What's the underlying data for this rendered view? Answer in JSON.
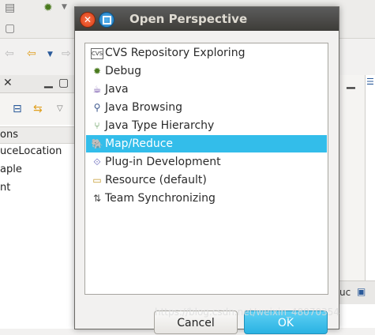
{
  "dialog": {
    "title": "Open Perspective",
    "perspectives": [
      {
        "label": "CVS Repository Exploring",
        "icon": "cvs-icon",
        "selected": false
      },
      {
        "label": "Debug",
        "icon": "debug-icon",
        "selected": false
      },
      {
        "label": "Java",
        "icon": "java-icon",
        "selected": false
      },
      {
        "label": "Java Browsing",
        "icon": "java-browsing-icon",
        "selected": false
      },
      {
        "label": "Java Type Hierarchy",
        "icon": "type-hierarchy-icon",
        "selected": false
      },
      {
        "label": "Map/Reduce",
        "icon": "map-reduce-icon",
        "selected": true
      },
      {
        "label": "Plug-in Development",
        "icon": "plugin-icon",
        "selected": false
      },
      {
        "label": "Resource (default)",
        "icon": "resource-icon",
        "selected": false
      },
      {
        "label": "Team Synchronizing",
        "icon": "team-sync-icon",
        "selected": false
      }
    ],
    "cancel_label": "Cancel",
    "ok_label": "OK"
  },
  "background": {
    "column_header": "ons",
    "items": [
      "uceLocation",
      "aple",
      "nt"
    ],
    "right_tab_label": "uc"
  },
  "watermark": "https://blog.csdn.net/weixin_48070354",
  "colors": {
    "selection": "#33bdea",
    "titlebar": "#3d3c38",
    "ok_button": "#29b2e2"
  }
}
